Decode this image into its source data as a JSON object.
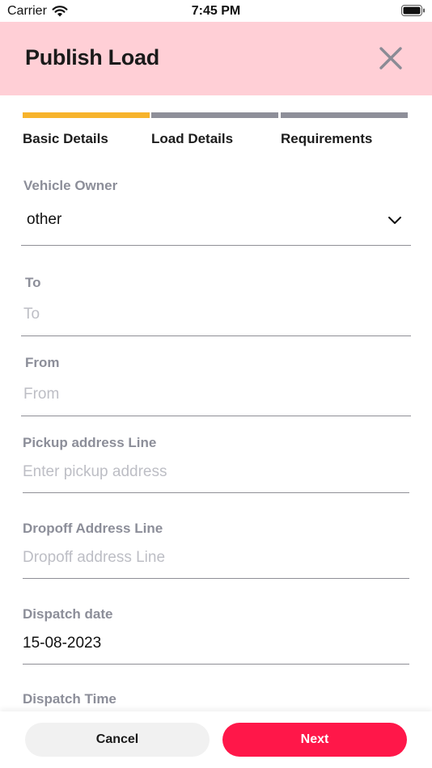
{
  "status_bar": {
    "carrier": "Carrier",
    "time": "7:45 PM"
  },
  "header": {
    "title": "Publish Load",
    "background": "#ffcfd6"
  },
  "stepper": {
    "active_color": "#f7b32b",
    "inactive_color": "#8e8f99",
    "steps": [
      {
        "label": "Basic Details",
        "active": true
      },
      {
        "label": "Load Details",
        "active": false
      },
      {
        "label": "Requirements",
        "active": false
      }
    ]
  },
  "form": {
    "vehicle_owner": {
      "label": "Vehicle Owner",
      "value": "other"
    },
    "to": {
      "label": "To",
      "placeholder": "To"
    },
    "from": {
      "label": "From",
      "placeholder": "From"
    },
    "pickup_address": {
      "label": "Pickup address Line",
      "placeholder": "Enter pickup address"
    },
    "dropoff_address": {
      "label": "Dropoff Address Line",
      "placeholder": "Dropoff address Line"
    },
    "dispatch_date": {
      "label": "Dispatch date",
      "value": "15-08-2023"
    },
    "dispatch_time": {
      "label": "Dispatch Time"
    }
  },
  "footer": {
    "cancel_label": "Cancel",
    "next_label": "Next",
    "next_color": "#ff1749"
  }
}
